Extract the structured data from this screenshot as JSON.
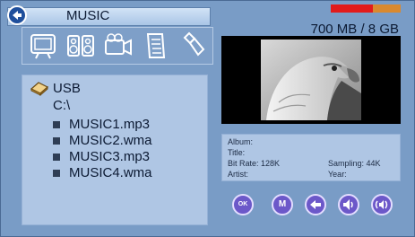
{
  "header": {
    "title": "MUSIC",
    "storage_text": "700 MB / 8 GB",
    "storage_used_fraction": 0.6,
    "colors": {
      "used": "#e21b1b",
      "free": "#d9892f"
    }
  },
  "toolbar": {
    "icons": [
      "photo-frame-icon",
      "speakers-icon",
      "video-camera-icon",
      "document-icon",
      "usb-stick-icon"
    ]
  },
  "browser": {
    "device_label": "USB",
    "path": "C:\\",
    "files": [
      "MUSIC1.mp3",
      "MUSIC2.wma",
      "MUSIC3.mp3",
      "MUSIC4.wma"
    ]
  },
  "info": {
    "album": "Album:",
    "title": "Title:",
    "bit_rate": "Bit Rate: 128K",
    "sampling": "Sampling: 44K",
    "artist": "Artist:",
    "year": "Year:"
  },
  "controls": {
    "ok": "OK",
    "mode": "M",
    "buttons": [
      "ok-button",
      "mode-button",
      "previous-button",
      "volume-down-button",
      "volume-up-button"
    ]
  }
}
